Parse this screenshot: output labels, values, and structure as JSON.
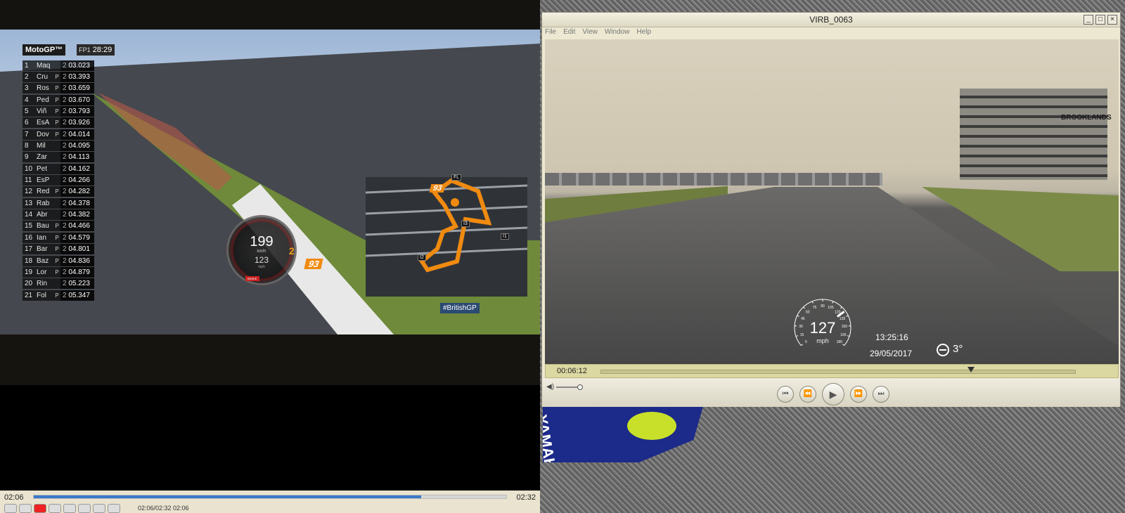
{
  "left_player": {
    "standings": {
      "logo": "MotoGP™",
      "session": "FP1",
      "session_time": "28:29",
      "rows": [
        {
          "pos": "1",
          "rider": "Maq",
          "pit": "",
          "lap": "2",
          "time": "03.023"
        },
        {
          "pos": "2",
          "rider": "Cru",
          "pit": "P",
          "lap": "2",
          "time": "03.393"
        },
        {
          "pos": "3",
          "rider": "Ros",
          "pit": "P",
          "lap": "2",
          "time": "03.659"
        },
        {
          "pos": "4",
          "rider": "Ped",
          "pit": "P",
          "lap": "2",
          "time": "03.670"
        },
        {
          "pos": "5",
          "rider": "Viñ",
          "pit": "P",
          "lap": "2",
          "time": "03.793"
        },
        {
          "pos": "6",
          "rider": "EsA",
          "pit": "P",
          "lap": "2",
          "time": "03.926"
        },
        {
          "pos": "7",
          "rider": "Dov",
          "pit": "P",
          "lap": "2",
          "time": "04.014"
        },
        {
          "pos": "8",
          "rider": "Mil",
          "pit": "",
          "lap": "2",
          "time": "04.095"
        },
        {
          "pos": "9",
          "rider": "Zar",
          "pit": "",
          "lap": "2",
          "time": "04.113"
        },
        {
          "pos": "10",
          "rider": "Pet",
          "pit": "",
          "lap": "2",
          "time": "04.162"
        },
        {
          "pos": "11",
          "rider": "EsP",
          "pit": "",
          "lap": "2",
          "time": "04.266"
        },
        {
          "pos": "12",
          "rider": "Red",
          "pit": "P",
          "lap": "2",
          "time": "04.282"
        },
        {
          "pos": "13",
          "rider": "Rab",
          "pit": "",
          "lap": "2",
          "time": "04.378"
        },
        {
          "pos": "14",
          "rider": "Abr",
          "pit": "",
          "lap": "2",
          "time": "04.382"
        },
        {
          "pos": "15",
          "rider": "Bau",
          "pit": "P",
          "lap": "2",
          "time": "04.466"
        },
        {
          "pos": "16",
          "rider": "Ian",
          "pit": "P",
          "lap": "2",
          "time": "04.579"
        },
        {
          "pos": "17",
          "rider": "Bar",
          "pit": "P",
          "lap": "2",
          "time": "04.801"
        },
        {
          "pos": "18",
          "rider": "Baz",
          "pit": "P",
          "lap": "2",
          "time": "04.836"
        },
        {
          "pos": "19",
          "rider": "Lor",
          "pit": "P",
          "lap": "2",
          "time": "04.879"
        },
        {
          "pos": "20",
          "rider": "Rin",
          "pit": "",
          "lap": "2",
          "time": "05.223"
        },
        {
          "pos": "21",
          "rider": "Fol",
          "pit": "P",
          "lap": "2",
          "time": "05.347"
        }
      ]
    },
    "speedo": {
      "speed_kmh": "199",
      "unit_kmh": "km/h",
      "speed_mph": "123",
      "unit_mph": "mph",
      "gear": "2",
      "brake": "BRAKE"
    },
    "rider_number": "93",
    "map_markers": {
      "fl": "FL",
      "i1": "I1",
      "i2": "I2",
      "i3": "I3"
    },
    "hashtag": "#BritishGP",
    "current_time": "02:06",
    "total_time": "02:32",
    "progress": 0.82,
    "clip_info": "02:06/02:32    02:06"
  },
  "right_window": {
    "title": "VIRB_0063",
    "menu": [
      "File",
      "Edit",
      "View",
      "Window",
      "Help"
    ],
    "window_buttons": {
      "minimize": "_",
      "maximize": "□",
      "close": "×"
    },
    "overlay": {
      "speed": "127",
      "unit": "mph",
      "gauge_ticks": [
        "0",
        "15",
        "30",
        "45",
        "60",
        "75",
        "90",
        "105",
        "120",
        "135",
        "150",
        "165",
        "180"
      ],
      "clock": "13:25:16",
      "date": "29/05/2017",
      "incline": "3°"
    },
    "scene_sign": "BROOKLANDS",
    "current_time": "00:06:12",
    "progress": 0.78,
    "transport": {
      "skip_back": "⏮",
      "rewind": "⏪",
      "play": "▶",
      "forward": "⏩",
      "skip_forward": "⏭"
    }
  },
  "bike_fragment": {
    "text": "YAMAHA"
  },
  "colors": {
    "accent_orange": "#f08a10",
    "seek_blue": "#3a79c9",
    "window_bg": "#ece8d2"
  }
}
